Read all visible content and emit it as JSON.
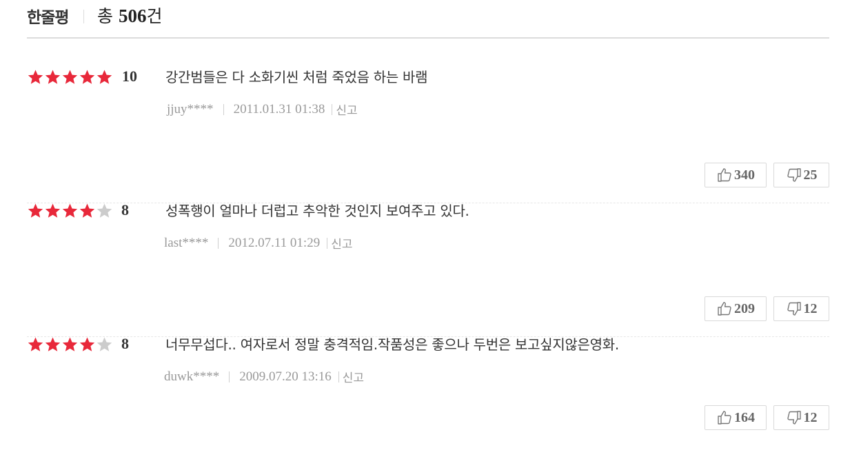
{
  "header": {
    "title": "한줄평",
    "total_prefix": "총 ",
    "total_count": "506",
    "total_suffix": "건"
  },
  "reviews": [
    {
      "rating_stars": 5,
      "score": "10",
      "comment": "강간범들은 다 소화기씬 처럼 죽었음 하는 바램",
      "user": "jjuy****",
      "date": "2011.01.31 01:38",
      "report": "신고",
      "likes": "340",
      "dislikes": "25"
    },
    {
      "rating_stars": 4,
      "score": "8",
      "comment": "성폭행이 얼마나 더럽고 추악한 것인지 보여주고 있다.",
      "user": "last****",
      "date": "2012.07.11 01:29",
      "report": "신고",
      "likes": "209",
      "dislikes": "12"
    },
    {
      "rating_stars": 4,
      "score": "8",
      "comment": "너무무섭다.. 여자로서 정말 충격적임.작품성은 좋으나 두번은 보고싶지않은영화.",
      "user": "duwk****",
      "date": "2009.07.20 13:16",
      "report": "신고",
      "likes": "164",
      "dislikes": "12"
    }
  ],
  "icons": {
    "star_filled": "star-filled-icon",
    "star_empty": "star-empty-icon",
    "thumbs_up": "thumbs-up-icon",
    "thumbs_down": "thumbs-down-icon"
  },
  "colors": {
    "star_filled": "#e8283a",
    "star_empty": "#cccccc",
    "divider": "#dcdcdc",
    "meta_text": "#999999"
  }
}
